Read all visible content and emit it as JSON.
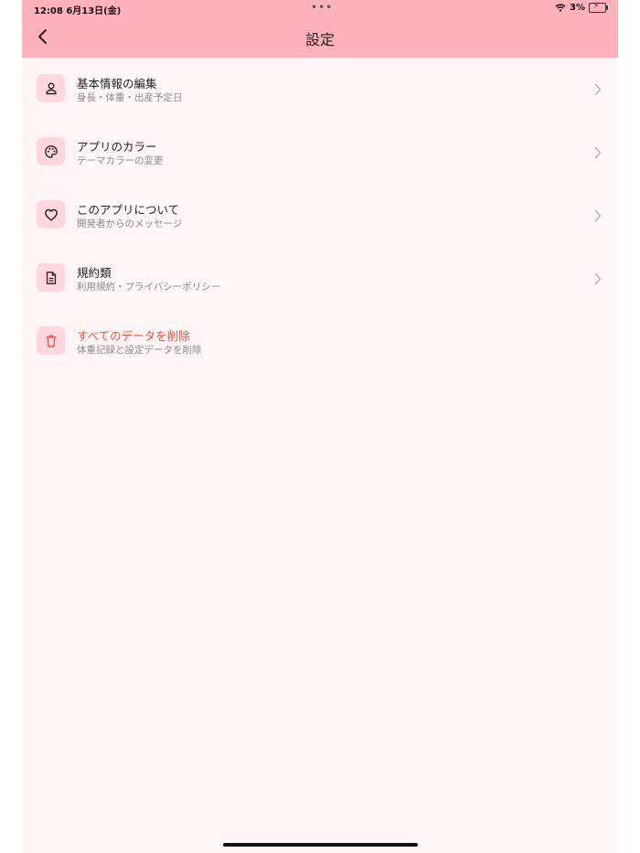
{
  "status_bar": {
    "time_date": "12:08   6月13日(金)",
    "battery": "3%"
  },
  "header": {
    "title": "設定"
  },
  "settings": [
    {
      "title": "基本情報の編集",
      "subtitle": "身長・体重・出産予定日",
      "icon": "person-icon",
      "has_chevron": true
    },
    {
      "title": "アプリのカラー",
      "subtitle": "テーマカラーの変更",
      "icon": "palette-icon",
      "has_chevron": true
    },
    {
      "title": "このアプリについて",
      "subtitle": "開発者からのメッセージ",
      "icon": "heart-icon",
      "has_chevron": true
    },
    {
      "title": "規約類",
      "subtitle": "利用規約・プライバシーポリシー",
      "icon": "document-icon",
      "has_chevron": true
    },
    {
      "title": "すべてのデータを削除",
      "subtitle": "体重記録と設定データを削除",
      "icon": "trash-icon",
      "has_chevron": false
    }
  ],
  "colors": {
    "header_bg": "#ffb2bc",
    "page_bg": "#fff6f5",
    "icon_bg": "#ffd7dc",
    "danger": "#e8534f"
  }
}
